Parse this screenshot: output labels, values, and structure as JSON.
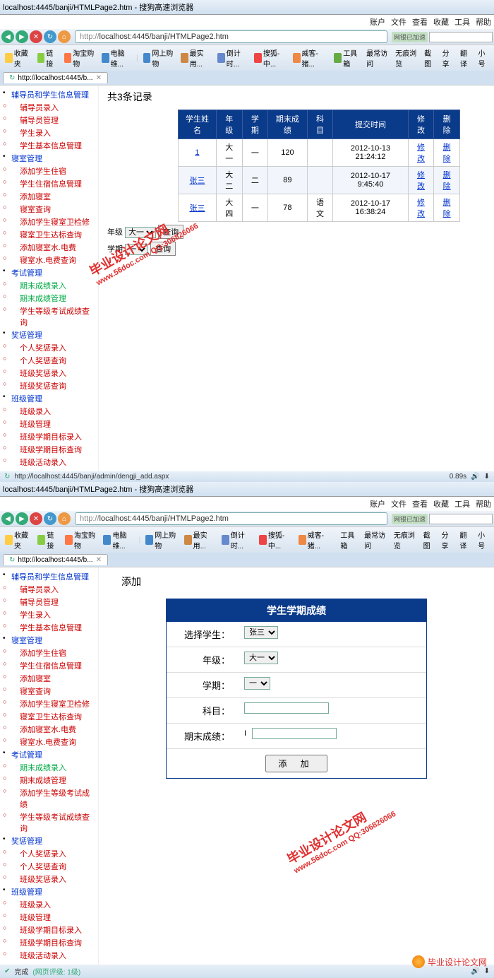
{
  "browser": {
    "title_suffix": "搜狗高速浏览器",
    "menu": [
      "账户",
      "文件",
      "查看",
      "收藏",
      "工具",
      "帮助"
    ],
    "url_prefix": "http://",
    "url": "localhost:4445/banji/HTMLPage2.htm",
    "url_badge": "网银已加速",
    "tab_title": "http://localhost:4445/b...",
    "nav_icons": [
      "back",
      "forward",
      "stop",
      "refresh",
      "home"
    ],
    "toolbar": [
      {
        "label": "收藏夹",
        "icon": "star"
      },
      {
        "label": "链接",
        "icon": "link"
      },
      {
        "label": "淘宝购物",
        "icon": "cart"
      },
      {
        "label": "电脑维...",
        "icon": "pc"
      },
      {
        "label": "网上购物",
        "icon": "bag"
      },
      {
        "label": "最实用...",
        "icon": "tool"
      },
      {
        "label": "倒计时...",
        "icon": "clock"
      },
      {
        "label": "搜狐-中...",
        "icon": "sohu"
      },
      {
        "label": "威客-猪...",
        "icon": "pig"
      },
      {
        "label": "工具箱",
        "icon": "box"
      },
      {
        "label": "最常访问",
        "icon": "list"
      },
      {
        "label": "无痕浏览",
        "icon": "eye"
      },
      {
        "label": "截图",
        "icon": "cam"
      },
      {
        "label": "分享",
        "icon": "share"
      },
      {
        "label": "翻译",
        "icon": "tr"
      },
      {
        "label": "小号",
        "icon": "mini"
      }
    ],
    "status1_url": "http://localhost:4445/banji/admin/dengji_add.aspx",
    "status1_time": "0.89s",
    "status2": "完成",
    "status2_extra": "(网页评级: 1级)"
  },
  "sidebar1": {
    "groups": [
      {
        "label": "辅导员和学生信息管理",
        "class": "blue",
        "children": [
          {
            "label": "辅导员录入",
            "class": "red"
          },
          {
            "label": "辅导员管理",
            "class": "red"
          },
          {
            "label": "学生录入",
            "class": "red"
          },
          {
            "label": "学生基本信息管理",
            "class": "red"
          }
        ]
      },
      {
        "label": "寝室管理",
        "class": "blue",
        "children": [
          {
            "label": "添加学生住宿",
            "class": "red"
          },
          {
            "label": "学生住宿信息管理",
            "class": "red"
          },
          {
            "label": "添加寝室",
            "class": "red"
          },
          {
            "label": "寝室查询",
            "class": "red"
          },
          {
            "label": "添加学生寝室卫检修",
            "class": "red"
          },
          {
            "label": "寝室卫生达标查询",
            "class": "red"
          },
          {
            "label": "添加寝室水.电费",
            "class": "red"
          },
          {
            "label": "寝室水.电费查询",
            "class": "red"
          }
        ]
      },
      {
        "label": "考试管理",
        "class": "blue",
        "children": [
          {
            "label": "期末成绩录入",
            "class": "green"
          },
          {
            "label": "期末成绩管理",
            "class": "green"
          },
          {
            "label": "学生等级考试成绩查询",
            "class": "red"
          }
        ]
      },
      {
        "label": "奖惩管理",
        "class": "blue",
        "children": [
          {
            "label": "个人奖惩录入",
            "class": "red"
          },
          {
            "label": "个人奖惩查询",
            "class": "red"
          },
          {
            "label": "班级奖惩录入",
            "class": "red"
          },
          {
            "label": "班级奖惩查询",
            "class": "red"
          }
        ]
      },
      {
        "label": "班级管理",
        "class": "blue",
        "children": [
          {
            "label": "班级录入",
            "class": "red"
          },
          {
            "label": "班级管理",
            "class": "red"
          },
          {
            "label": "班级学期目标录入",
            "class": "red"
          },
          {
            "label": "班级学期目标查询",
            "class": "red"
          },
          {
            "label": "班级活动录入",
            "class": "red"
          }
        ]
      }
    ]
  },
  "sidebar2": {
    "groups": [
      {
        "label": "辅导员和学生信息管理",
        "class": "blue",
        "children": [
          {
            "label": "辅导员录入",
            "class": "red"
          },
          {
            "label": "辅导员管理",
            "class": "red"
          },
          {
            "label": "学生录入",
            "class": "red"
          },
          {
            "label": "学生基本信息管理",
            "class": "red"
          }
        ]
      },
      {
        "label": "寝室管理",
        "class": "blue",
        "children": [
          {
            "label": "添加学生住宿",
            "class": "red"
          },
          {
            "label": "学生住宿信息管理",
            "class": "red"
          },
          {
            "label": "添加寝室",
            "class": "red"
          },
          {
            "label": "寝室查询",
            "class": "red"
          },
          {
            "label": "添加学生寝室卫检修",
            "class": "red"
          },
          {
            "label": "寝室卫生达标查询",
            "class": "red"
          },
          {
            "label": "添加寝室水.电费",
            "class": "red"
          },
          {
            "label": "寝室水.电费查询",
            "class": "red"
          }
        ]
      },
      {
        "label": "考试管理",
        "class": "blue",
        "children": [
          {
            "label": "期末成绩录入",
            "class": "green"
          },
          {
            "label": "期末成绩管理",
            "class": "red"
          },
          {
            "label": "添加学生等级考试成绩",
            "class": "red"
          },
          {
            "label": "学生等级考试成绩查询",
            "class": "red"
          }
        ]
      },
      {
        "label": "奖惩管理",
        "class": "blue",
        "children": [
          {
            "label": "个人奖惩录入",
            "class": "red"
          },
          {
            "label": "个人奖惩查询",
            "class": "red"
          },
          {
            "label": "班级奖惩录入",
            "class": "red"
          }
        ]
      },
      {
        "label": "班级管理",
        "class": "blue",
        "children": [
          {
            "label": "班级录入",
            "class": "red"
          },
          {
            "label": "班级管理",
            "class": "red"
          },
          {
            "label": "班级学期目标录入",
            "class": "red"
          },
          {
            "label": "班级学期目标查询",
            "class": "red"
          },
          {
            "label": "班级活动录入",
            "class": "red"
          }
        ]
      }
    ]
  },
  "page1": {
    "title": "共3条记录",
    "table": {
      "headers": [
        "学生姓名",
        "年级",
        "学期",
        "期末成绩",
        "科目",
        "提交时间",
        "修改",
        "删除"
      ],
      "rows": [
        {
          "name": "1",
          "grade": "大一",
          "term": "一",
          "score": "120",
          "subject": "",
          "time": "2012-10-13 21:24:12",
          "edit": "修改",
          "del": "删除"
        },
        {
          "name": "张三",
          "grade": "大二",
          "term": "二",
          "score": "89",
          "subject": "",
          "time": "2012-10-17 9:45:40",
          "edit": "修改",
          "del": "删除"
        },
        {
          "name": "张三",
          "grade": "大四",
          "term": "一",
          "score": "78",
          "subject": "语文",
          "time": "2012-10-17 16:38:24",
          "edit": "修改",
          "del": "删除"
        }
      ]
    },
    "search": {
      "grade_label": "年级",
      "grade_value": "大一",
      "grade_btn": "查询",
      "term_label": "学期",
      "term_value": "一",
      "term_btn": "查询"
    }
  },
  "page2": {
    "title": "添加",
    "form_title": "学生学期成绩",
    "fields": {
      "student_label": "选择学生：",
      "student_value": "张三",
      "grade_label": "年级：",
      "grade_value": "大一",
      "term_label": "学期：",
      "term_value": "一",
      "subject_label": "科目：",
      "subject_value": "",
      "score_label": "期末成绩：",
      "score_value": ""
    },
    "submit": "添   加"
  },
  "watermark": {
    "text1": "毕业设计论文网",
    "text2": "www.56doc.com   QQ:306826066"
  },
  "footer_logo": "毕业设计论文网"
}
